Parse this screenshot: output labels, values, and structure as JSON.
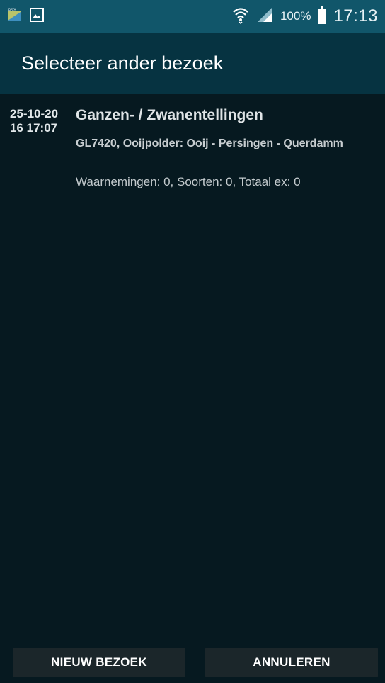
{
  "status_bar": {
    "battery_percent": "100%",
    "time": "17:13",
    "icons": [
      "data-icon",
      "image-icon",
      "wifi-icon",
      "signal-icon",
      "battery-icon"
    ]
  },
  "header": {
    "title": "Selecteer ander bezoek"
  },
  "visits": [
    {
      "date": "25-10-20\n16 17:07",
      "title": "Ganzen- / Zwanentellingen",
      "location": "GL7420, Ooijpolder: Ooij - Persingen - Querdamm",
      "stats": "Waarnemingen: 0, Soorten: 0, Totaal ex: 0"
    }
  ],
  "buttons": {
    "new_visit": "NIEUW BEZOEK",
    "cancel": "ANNULEREN"
  },
  "colors": {
    "status_bar": "#11566a",
    "title_bar": "#063341",
    "background": "#061920",
    "button": "#1b262a"
  }
}
